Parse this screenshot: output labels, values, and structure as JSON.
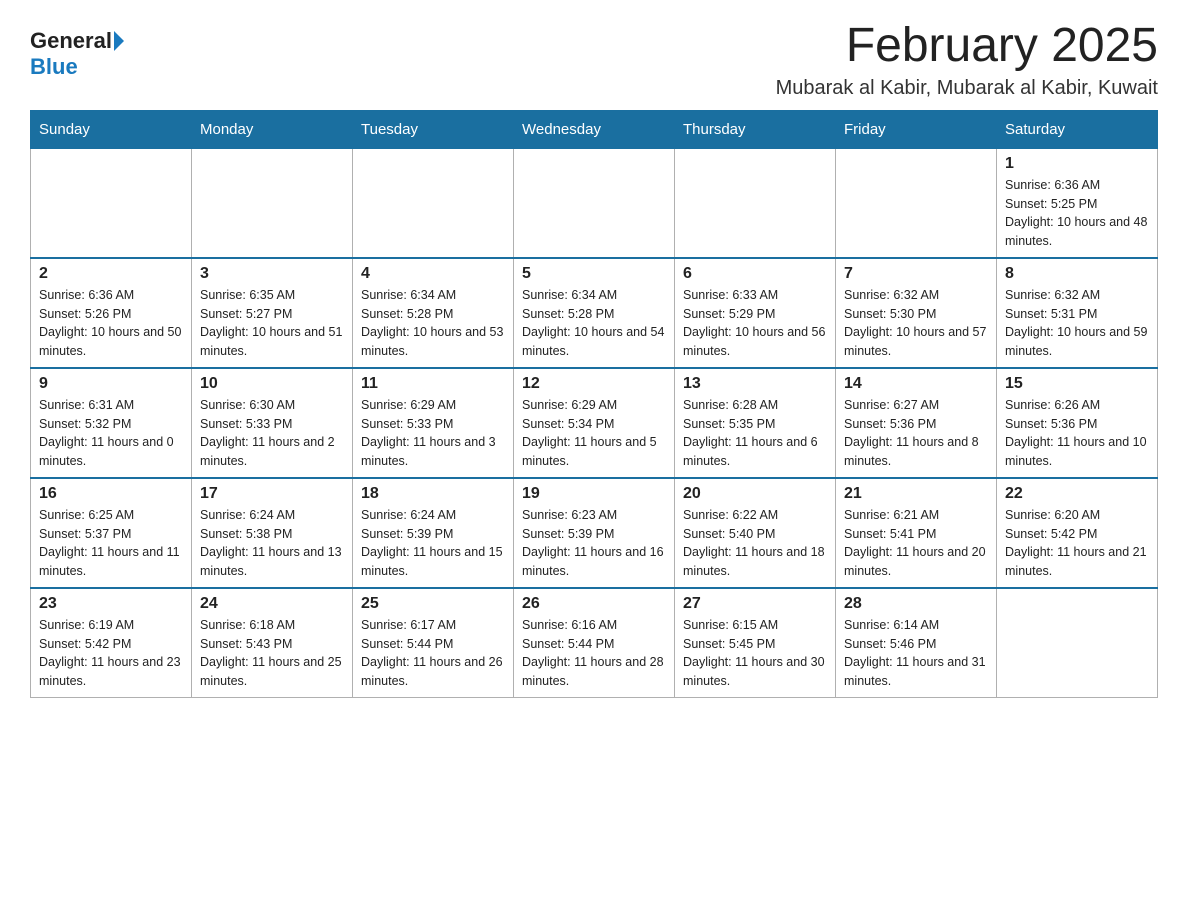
{
  "logo": {
    "general": "General",
    "blue": "Blue"
  },
  "title": "February 2025",
  "location": "Mubarak al Kabir, Mubarak al Kabir, Kuwait",
  "days_of_week": [
    "Sunday",
    "Monday",
    "Tuesday",
    "Wednesday",
    "Thursday",
    "Friday",
    "Saturday"
  ],
  "weeks": [
    [
      {
        "day": "",
        "info": ""
      },
      {
        "day": "",
        "info": ""
      },
      {
        "day": "",
        "info": ""
      },
      {
        "day": "",
        "info": ""
      },
      {
        "day": "",
        "info": ""
      },
      {
        "day": "",
        "info": ""
      },
      {
        "day": "1",
        "info": "Sunrise: 6:36 AM\nSunset: 5:25 PM\nDaylight: 10 hours and 48 minutes."
      }
    ],
    [
      {
        "day": "2",
        "info": "Sunrise: 6:36 AM\nSunset: 5:26 PM\nDaylight: 10 hours and 50 minutes."
      },
      {
        "day": "3",
        "info": "Sunrise: 6:35 AM\nSunset: 5:27 PM\nDaylight: 10 hours and 51 minutes."
      },
      {
        "day": "4",
        "info": "Sunrise: 6:34 AM\nSunset: 5:28 PM\nDaylight: 10 hours and 53 minutes."
      },
      {
        "day": "5",
        "info": "Sunrise: 6:34 AM\nSunset: 5:28 PM\nDaylight: 10 hours and 54 minutes."
      },
      {
        "day": "6",
        "info": "Sunrise: 6:33 AM\nSunset: 5:29 PM\nDaylight: 10 hours and 56 minutes."
      },
      {
        "day": "7",
        "info": "Sunrise: 6:32 AM\nSunset: 5:30 PM\nDaylight: 10 hours and 57 minutes."
      },
      {
        "day": "8",
        "info": "Sunrise: 6:32 AM\nSunset: 5:31 PM\nDaylight: 10 hours and 59 minutes."
      }
    ],
    [
      {
        "day": "9",
        "info": "Sunrise: 6:31 AM\nSunset: 5:32 PM\nDaylight: 11 hours and 0 minutes."
      },
      {
        "day": "10",
        "info": "Sunrise: 6:30 AM\nSunset: 5:33 PM\nDaylight: 11 hours and 2 minutes."
      },
      {
        "day": "11",
        "info": "Sunrise: 6:29 AM\nSunset: 5:33 PM\nDaylight: 11 hours and 3 minutes."
      },
      {
        "day": "12",
        "info": "Sunrise: 6:29 AM\nSunset: 5:34 PM\nDaylight: 11 hours and 5 minutes."
      },
      {
        "day": "13",
        "info": "Sunrise: 6:28 AM\nSunset: 5:35 PM\nDaylight: 11 hours and 6 minutes."
      },
      {
        "day": "14",
        "info": "Sunrise: 6:27 AM\nSunset: 5:36 PM\nDaylight: 11 hours and 8 minutes."
      },
      {
        "day": "15",
        "info": "Sunrise: 6:26 AM\nSunset: 5:36 PM\nDaylight: 11 hours and 10 minutes."
      }
    ],
    [
      {
        "day": "16",
        "info": "Sunrise: 6:25 AM\nSunset: 5:37 PM\nDaylight: 11 hours and 11 minutes."
      },
      {
        "day": "17",
        "info": "Sunrise: 6:24 AM\nSunset: 5:38 PM\nDaylight: 11 hours and 13 minutes."
      },
      {
        "day": "18",
        "info": "Sunrise: 6:24 AM\nSunset: 5:39 PM\nDaylight: 11 hours and 15 minutes."
      },
      {
        "day": "19",
        "info": "Sunrise: 6:23 AM\nSunset: 5:39 PM\nDaylight: 11 hours and 16 minutes."
      },
      {
        "day": "20",
        "info": "Sunrise: 6:22 AM\nSunset: 5:40 PM\nDaylight: 11 hours and 18 minutes."
      },
      {
        "day": "21",
        "info": "Sunrise: 6:21 AM\nSunset: 5:41 PM\nDaylight: 11 hours and 20 minutes."
      },
      {
        "day": "22",
        "info": "Sunrise: 6:20 AM\nSunset: 5:42 PM\nDaylight: 11 hours and 21 minutes."
      }
    ],
    [
      {
        "day": "23",
        "info": "Sunrise: 6:19 AM\nSunset: 5:42 PM\nDaylight: 11 hours and 23 minutes."
      },
      {
        "day": "24",
        "info": "Sunrise: 6:18 AM\nSunset: 5:43 PM\nDaylight: 11 hours and 25 minutes."
      },
      {
        "day": "25",
        "info": "Sunrise: 6:17 AM\nSunset: 5:44 PM\nDaylight: 11 hours and 26 minutes."
      },
      {
        "day": "26",
        "info": "Sunrise: 6:16 AM\nSunset: 5:44 PM\nDaylight: 11 hours and 28 minutes."
      },
      {
        "day": "27",
        "info": "Sunrise: 6:15 AM\nSunset: 5:45 PM\nDaylight: 11 hours and 30 minutes."
      },
      {
        "day": "28",
        "info": "Sunrise: 6:14 AM\nSunset: 5:46 PM\nDaylight: 11 hours and 31 minutes."
      },
      {
        "day": "",
        "info": ""
      }
    ]
  ]
}
